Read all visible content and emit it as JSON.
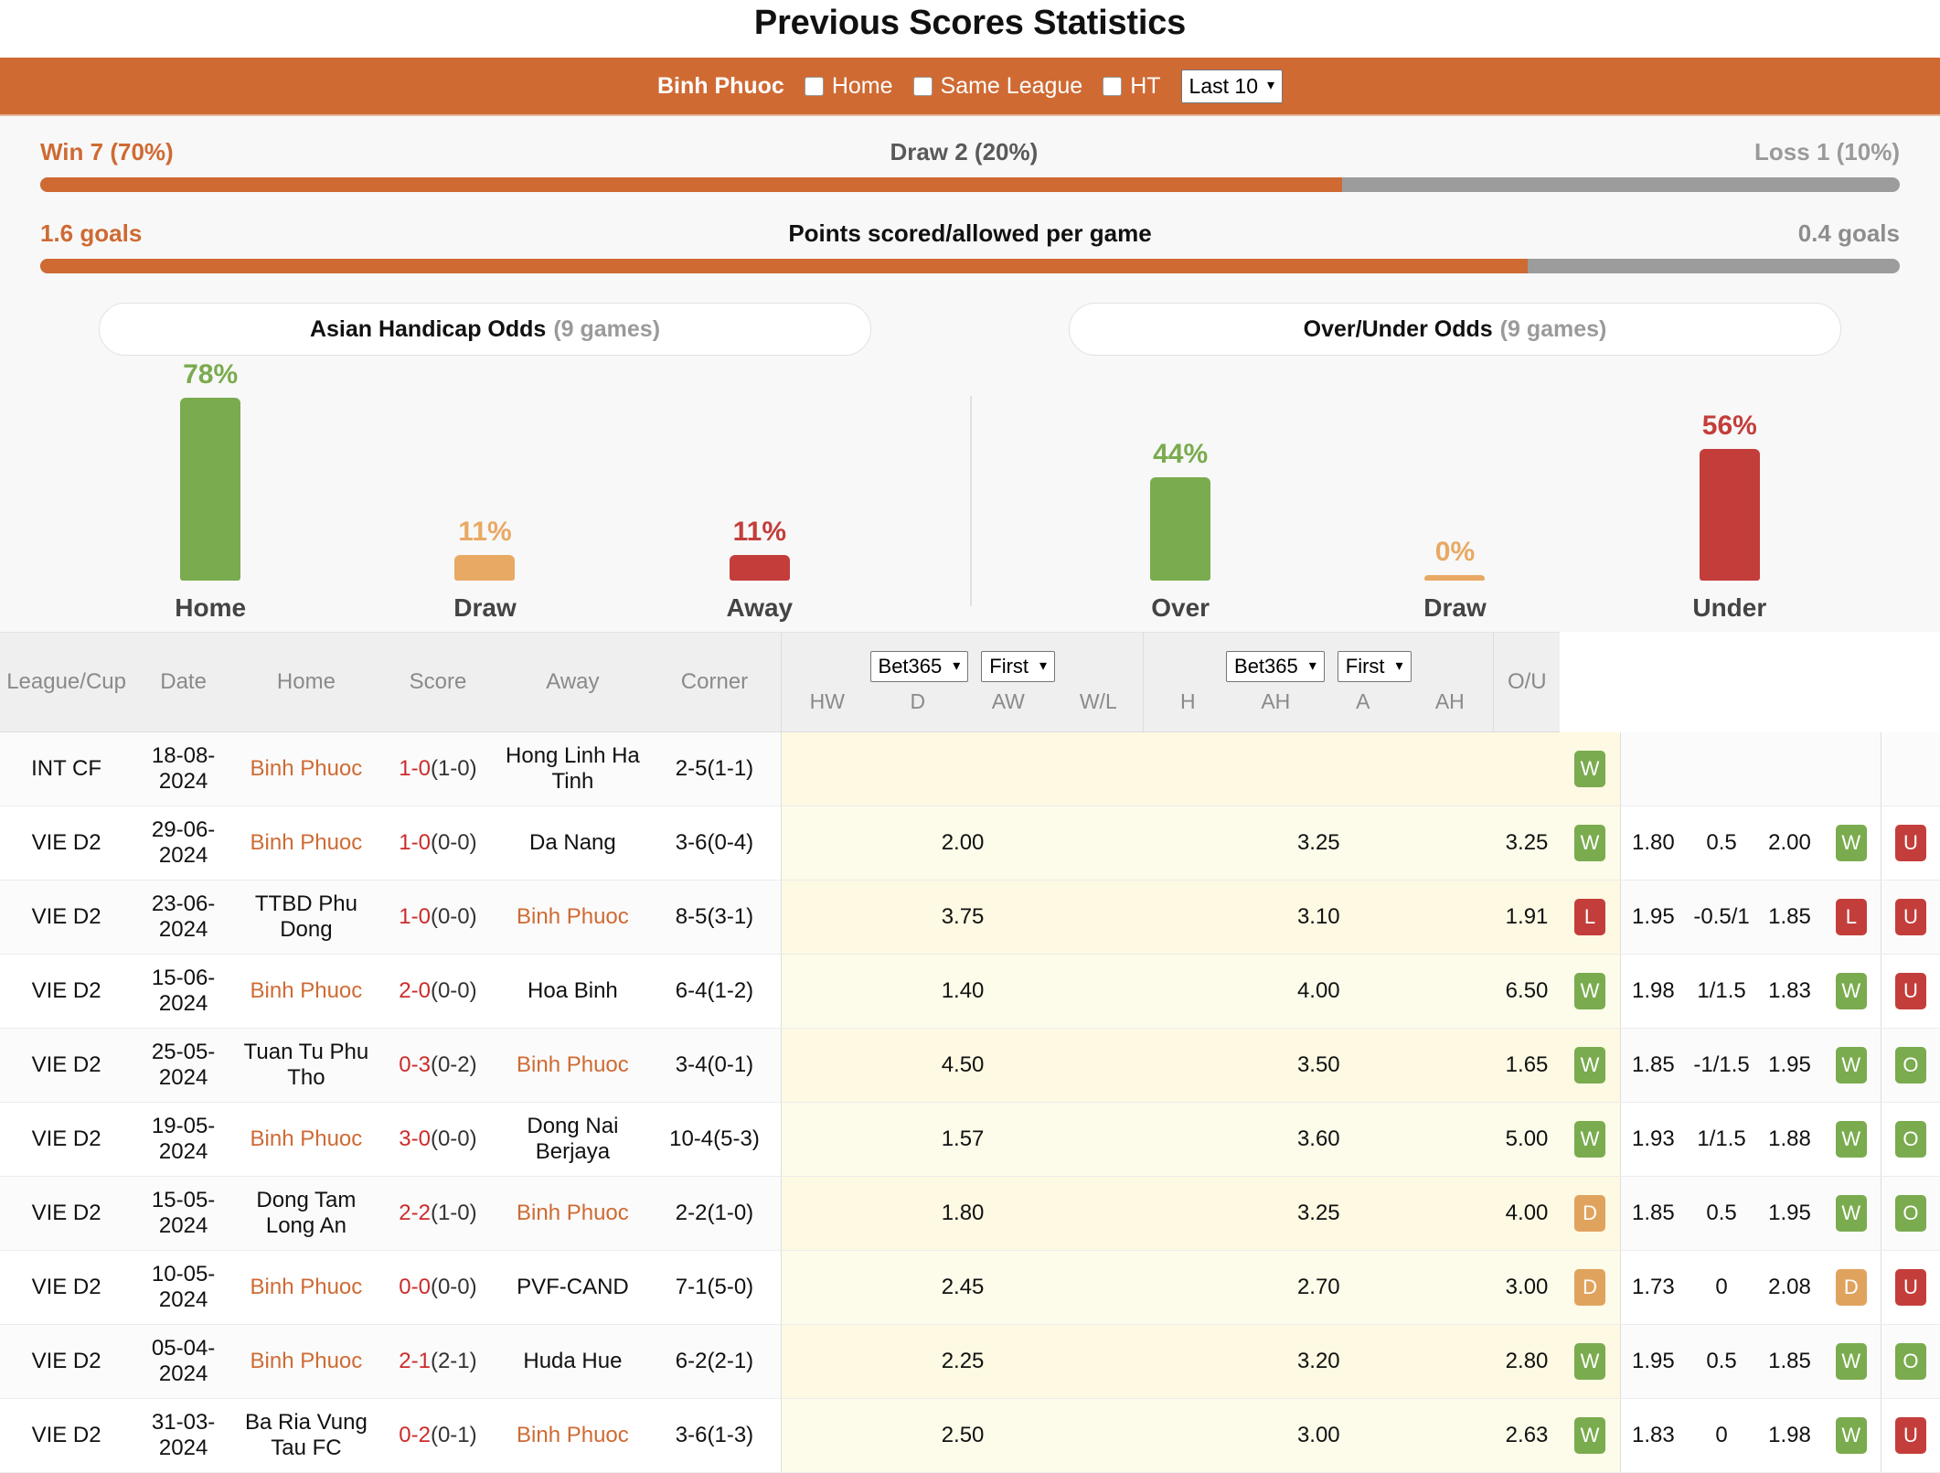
{
  "page_title": "Previous Scores Statistics",
  "control_bar": {
    "team": "Binh Phuoc",
    "checkboxes": [
      {
        "label": "Home",
        "checked": false
      },
      {
        "label": "Same League",
        "checked": false
      },
      {
        "label": "HT",
        "checked": false
      }
    ],
    "range_select": {
      "value": "Last 10",
      "caret": "chevron-down-icon"
    }
  },
  "summary": {
    "win": "Win 7 (70%)",
    "draw": "Draw 2 (20%)",
    "loss": "Loss 1 (10%)",
    "wdl_fill_pct": 70,
    "goals_for": "1.6 goals",
    "goals_title": "Points scored/allowed per game",
    "goals_against": "0.4 goals",
    "goals_fill_pct": 80
  },
  "panels": [
    {
      "title": "Asian Handicap Odds",
      "games": "(9 games)",
      "bars": [
        {
          "name": "Home",
          "pct": "78%",
          "value": 78,
          "color": "#7aab4e"
        },
        {
          "name": "Draw",
          "pct": "11%",
          "value": 11,
          "color": "#e8a964"
        },
        {
          "name": "Away",
          "pct": "11%",
          "value": 11,
          "color": "#c33e3b"
        }
      ]
    },
    {
      "title": "Over/Under Odds",
      "games": "(9 games)",
      "bars": [
        {
          "name": "Over",
          "pct": "44%",
          "value": 44,
          "color": "#7aab4e"
        },
        {
          "name": "Draw",
          "pct": "0%",
          "value": 0,
          "color": "#e8a964"
        },
        {
          "name": "Under",
          "pct": "56%",
          "value": 56,
          "color": "#c33e3b"
        }
      ]
    }
  ],
  "table": {
    "headers": {
      "league": "League/Cup",
      "date": "Date",
      "home": "Home",
      "score": "Score",
      "away": "Away",
      "corner": "Corner",
      "ou": "O/U",
      "group1": {
        "bookmaker": "Bet365",
        "period": "First",
        "cols": [
          "HW",
          "D",
          "AW",
          "W/L"
        ]
      },
      "group2": {
        "bookmaker": "Bet365",
        "period": "First",
        "cols": [
          "H",
          "AH",
          "A",
          "AH"
        ]
      }
    },
    "rows": [
      {
        "league": "INT CF",
        "date": "18-08-2024",
        "home": "Binh Phuoc",
        "home_hl": true,
        "score_main": "1-0",
        "score_ht": "(1-0)",
        "away": "Hong Linh Ha Tinh",
        "away_hl": false,
        "corner": "2-5(1-1)",
        "hw": "",
        "d": "",
        "aw": "",
        "wl": "W",
        "h": "",
        "ah1": "",
        "a": "",
        "ah2": "",
        "ou": ""
      },
      {
        "league": "VIE D2",
        "date": "29-06-2024",
        "home": "Binh Phuoc",
        "home_hl": true,
        "score_main": "1-0",
        "score_ht": "(0-0)",
        "away": "Da Nang",
        "away_hl": false,
        "corner": "3-6(0-4)",
        "hw": "2.00",
        "d": "3.25",
        "aw": "3.25",
        "wl": "W",
        "h": "1.80",
        "ah1": "0.5",
        "a": "2.00",
        "ah2": "W",
        "ou": "U"
      },
      {
        "league": "VIE D2",
        "date": "23-06-2024",
        "home": "TTBD Phu Dong",
        "home_hl": false,
        "score_main": "1-0",
        "score_ht": "(0-0)",
        "away": "Binh Phuoc",
        "away_hl": true,
        "corner": "8-5(3-1)",
        "hw": "3.75",
        "d": "3.10",
        "aw": "1.91",
        "wl": "L",
        "h": "1.95",
        "ah1": "-0.5/1",
        "a": "1.85",
        "ah2": "L",
        "ou": "U"
      },
      {
        "league": "VIE D2",
        "date": "15-06-2024",
        "home": "Binh Phuoc",
        "home_hl": true,
        "score_main": "2-0",
        "score_ht": "(0-0)",
        "away": "Hoa Binh",
        "away_hl": false,
        "corner": "6-4(1-2)",
        "hw": "1.40",
        "d": "4.00",
        "aw": "6.50",
        "wl": "W",
        "h": "1.98",
        "ah1": "1/1.5",
        "a": "1.83",
        "ah2": "W",
        "ou": "U"
      },
      {
        "league": "VIE D2",
        "date": "25-05-2024",
        "home": "Tuan Tu Phu Tho",
        "home_hl": false,
        "score_main": "0-3",
        "score_ht": "(0-2)",
        "away": "Binh Phuoc",
        "away_hl": true,
        "corner": "3-4(0-1)",
        "hw": "4.50",
        "d": "3.50",
        "aw": "1.65",
        "wl": "W",
        "h": "1.85",
        "ah1": "-1/1.5",
        "a": "1.95",
        "ah2": "W",
        "ou": "O"
      },
      {
        "league": "VIE D2",
        "date": "19-05-2024",
        "home": "Binh Phuoc",
        "home_hl": true,
        "score_main": "3-0",
        "score_ht": "(0-0)",
        "away": "Dong Nai Berjaya",
        "away_hl": false,
        "corner": "10-4(5-3)",
        "hw": "1.57",
        "d": "3.60",
        "aw": "5.00",
        "wl": "W",
        "h": "1.93",
        "ah1": "1/1.5",
        "a": "1.88",
        "ah2": "W",
        "ou": "O"
      },
      {
        "league": "VIE D2",
        "date": "15-05-2024",
        "home": "Dong Tam Long An",
        "home_hl": false,
        "score_main": "2-2",
        "score_ht": "(1-0)",
        "away": "Binh Phuoc",
        "away_hl": true,
        "corner": "2-2(1-0)",
        "hw": "1.80",
        "d": "3.25",
        "aw": "4.00",
        "wl": "D",
        "h": "1.85",
        "ah1": "0.5",
        "a": "1.95",
        "ah2": "W",
        "ou": "O"
      },
      {
        "league": "VIE D2",
        "date": "10-05-2024",
        "home": "Binh Phuoc",
        "home_hl": true,
        "score_main": "0-0",
        "score_ht": "(0-0)",
        "away": "PVF-CAND",
        "away_hl": false,
        "corner": "7-1(5-0)",
        "hw": "2.45",
        "d": "2.70",
        "aw": "3.00",
        "wl": "D",
        "h": "1.73",
        "ah1": "0",
        "a": "2.08",
        "ah2": "D",
        "ou": "U"
      },
      {
        "league": "VIE D2",
        "date": "05-04-2024",
        "home": "Binh Phuoc",
        "home_hl": true,
        "score_main": "2-1",
        "score_ht": "(2-1)",
        "away": "Huda Hue",
        "away_hl": false,
        "corner": "6-2(2-1)",
        "hw": "2.25",
        "d": "3.20",
        "aw": "2.80",
        "wl": "W",
        "h": "1.95",
        "ah1": "0.5",
        "a": "1.85",
        "ah2": "W",
        "ou": "O"
      },
      {
        "league": "VIE D2",
        "date": "31-03-2024",
        "home": "Ba Ria Vung Tau FC",
        "home_hl": false,
        "score_main": "0-2",
        "score_ht": "(0-1)",
        "away": "Binh Phuoc",
        "away_hl": true,
        "corner": "3-6(1-3)",
        "hw": "2.50",
        "d": "3.00",
        "aw": "2.63",
        "wl": "W",
        "h": "1.83",
        "ah1": "0",
        "a": "1.98",
        "ah2": "W",
        "ou": "U"
      }
    ]
  },
  "colors": {
    "brand_orange": "#cf6a33",
    "green": "#7aab4e",
    "red": "#c33e3b",
    "amber": "#e8a964",
    "gray": "#9c9c9c"
  }
}
